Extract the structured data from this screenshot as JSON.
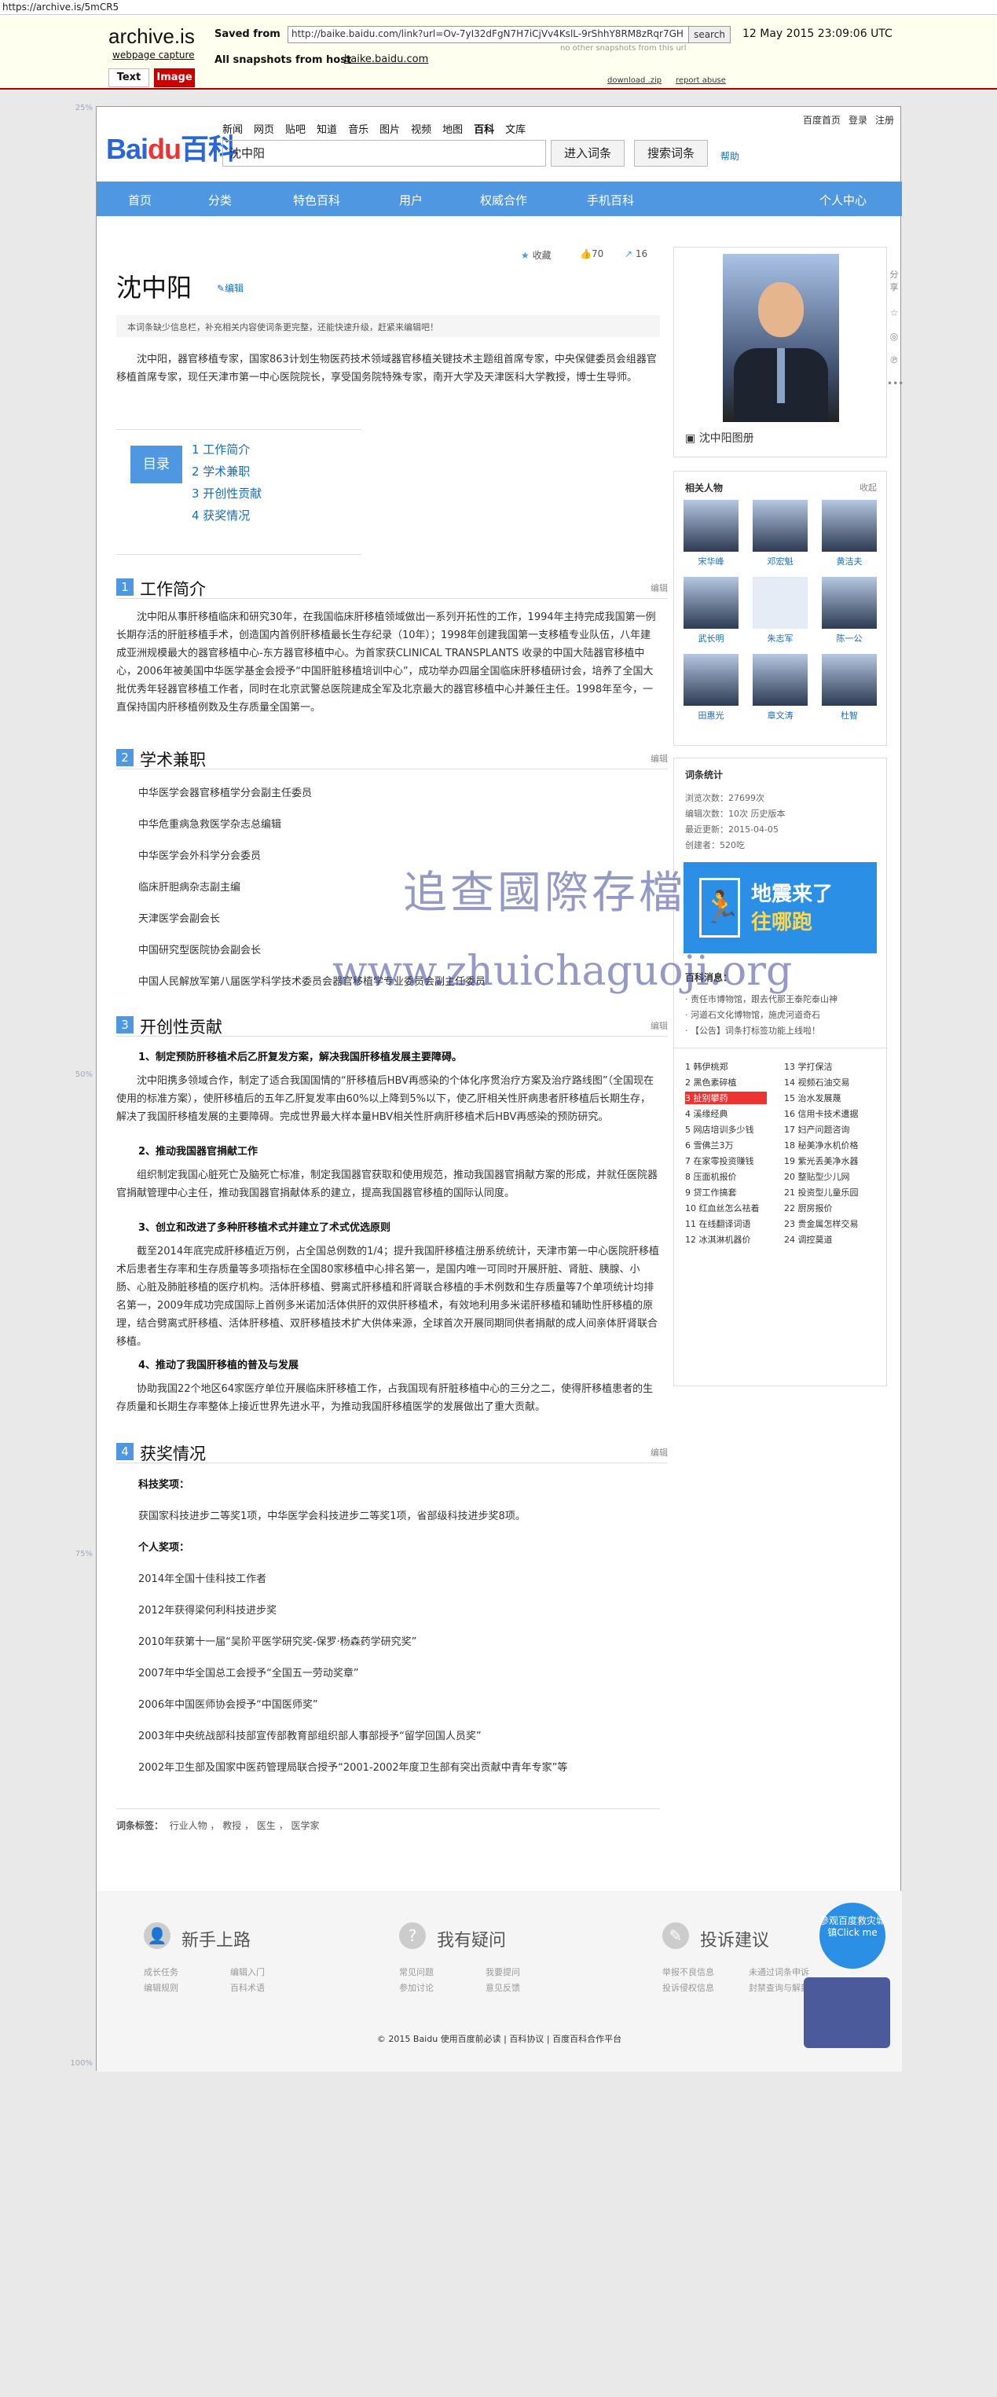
{
  "archive": {
    "urlbar": "https://archive.is/5mCR5",
    "logo": "archive.is",
    "webpage_capture": "webpage capture",
    "saved_from_label": "Saved from",
    "saved_url": "http://baike.baidu.com/link?url=Ov-7yI32dFgN7H7iCjVv4KslL-9rShhY8RM8zRqr7GH",
    "search_button": "search",
    "date": "12 May 2015 23:09:06 UTC",
    "no_other": "no other snapshots from this url",
    "all_snapshots_label": "All snapshots from host",
    "host": "baike.baidu.com",
    "tab_text": "Text",
    "tab_image": "Image",
    "download": "download .zip",
    "report": "report abuse",
    "ruler": [
      "25%",
      "50%",
      "75%",
      "100%"
    ]
  },
  "baike": {
    "logo_a": "Bai",
    "logo_b": "du",
    "logo_c": "百科",
    "categories": [
      "新闻",
      "网页",
      "贴吧",
      "知道",
      "音乐",
      "图片",
      "视频",
      "地图",
      "百科",
      "文库"
    ],
    "current_category": "百科",
    "search_value": "沈中阳",
    "enter_button": "进入词条",
    "search_button": "搜索词条",
    "help": "帮助",
    "top_right": [
      "百度首页",
      "登录",
      "注册"
    ],
    "mainnav": [
      "首页",
      "分类",
      "特色百科",
      "用户",
      "权威合作",
      "手机百科",
      "个人中心"
    ]
  },
  "article": {
    "collect": "收藏",
    "likes": "70",
    "shares": "16",
    "title": "沈中阳",
    "edit": "编辑",
    "notice": "本词条缺少信息栏，补充相关内容使词条更完整，还能快速升级，赶紧来编辑吧！",
    "lead": "沈中阳，器官移植专家，国家863计划生物医药技术领域器官移植关键技术主题组首席专家，中央保健委员会组器官移植首席专家，现任天津市第一中心医院院长，享受国务院特殊专家，南开大学及天津医科大学教授，博士生导师。",
    "toc_title": "目录",
    "toc": [
      "1  工作简介",
      "2  学术兼职",
      "3  开创性贡献",
      "4  获奖情况"
    ],
    "sections": [
      {
        "num": "1",
        "title": "工作简介",
        "edit": "编辑"
      },
      {
        "num": "2",
        "title": "学术兼职",
        "edit": "编辑"
      },
      {
        "num": "3",
        "title": "开创性贡献",
        "edit": "编辑"
      },
      {
        "num": "4",
        "title": "获奖情况",
        "edit": "编辑"
      }
    ],
    "work": "沈中阳从事肝移植临床和研究30年，在我国临床肝移植领域做出一系列开拓性的工作，1994年主持完成我国第一例长期存活的肝脏移植手术，创造国内首例肝移植最长生存纪录（10年）；1998年创建我国第一支移植专业队伍，八年建成亚洲规模最大的器官移植中心-东方器官移植中心。为首家获CLINICAL TRANSPLANTS 收录的中国大陆器官移植中心，2006年被美国中华医学基金会授予“中国肝脏移植培训中心”，成功举办四届全国临床肝移植研讨会，培养了全国大批优秀年轻器官移植工作者，同时在北京武警总医院建成全军及北京最大的器官移植中心并兼任主任。1998年至今，一直保持国内肝移植例数及生存质量全国第一。",
    "academic": [
      "中华医学会器官移植学分会副主任委员",
      "中华危重病急救医学杂志总编辑",
      "中华医学会外科学分会委员",
      "临床肝胆病杂志副主编",
      "天津医学会副会长",
      "中国研究型医院协会副会长",
      "中国人民解放军第八届医学科学技术委员会器官移植学专业委员会副主任委员"
    ],
    "contrib": [
      {
        "h": "1、制定预防肝移植术后乙肝复发方案，解决我国肝移植发展主要障碍。",
        "p": "沈中阳携多领域合作，制定了适合我国国情的“肝移植后HBV再感染的个体化序贯治疗方案及治疗路线图”（全国现在使用的标准方案），使肝移植后的五年乙肝复发率由60%以上降到5%以下，使乙肝相关性肝病患者肝移植后长期生存，解决了我国肝移植发展的主要障碍。完成世界最大样本量HBV相关性肝病肝移植术后HBV再感染的预防研究。"
      },
      {
        "h": "2、推动我国器官捐献工作",
        "p": "组织制定我国心脏死亡及脑死亡标准，制定我国器官获取和使用规范，推动我国器官捐献方案的形成，并就任医院器官捐献管理中心主任，推动我国器官捐献体系的建立，提高我国器官移植的国际认同度。"
      },
      {
        "h": "3、创立和改进了多种肝移植术式并建立了术式优选原则",
        "p": "截至2014年底完成肝移植近万例，占全国总例数的1/4；提升我国肝移植注册系统统计，天津市第一中心医院肝移植术后患者生存率和生存质量等多项指标在全国80家移植中心排名第一，是国内唯一可同时开展肝脏、肾脏、胰腺、小肠、心脏及肺脏移植的医疗机构。活体肝移植、劈离式肝移植和肝肾联合移植的手术例数和生存质量等7个单项统计均排名第一，2009年成功完成国际上首例多米诺加活体供肝的双供肝移植术，有效地利用多米诺肝移植和辅助性肝移植的原理，结合劈离式肝移植、活体肝移植、双肝移植技术扩大供体来源，全球首次开展同期同供者捐献的成人间亲体肝肾联合移植。"
      },
      {
        "h": "4、推动了我国肝移植的普及与发展",
        "p": "协助我国22个地区64家医疗单位开展临床肝移植工作，占我国现有肝脏移植中心的三分之二，使得肝移植患者的生存质量和长期生存率整体上接近世界先进水平，为推动我国肝移植医学的发展做出了重大贡献。"
      }
    ],
    "awards_tech_h": "科技奖项：",
    "awards_tech": "获国家科技进步二等奖1项，中华医学会科技进步二等奖1项，省部级科技进步奖8项。",
    "awards_personal_h": "个人奖项：",
    "awards": [
      "2014年全国十佳科技工作者",
      "2012年获得梁何利科技进步奖",
      "2010年获第十一届“吴阶平医学研究奖-保罗·杨森药学研究奖”",
      "2007年中华全国总工会授予“全国五一劳动奖章”",
      "2006年中国医师协会授予“中国医师奖”",
      "2003年中央统战部科技部宣传部教育部组织部人事部授予“留学回国人员奖”",
      "2002年卫生部及国家中医药管理局联合授予“2001-2002年度卫生部有突出贡献中青年专家”等"
    ],
    "tags_label": "词条标签：",
    "tags": "行业人物 ， 教授 ， 医生 ， 医学家"
  },
  "sidebar": {
    "album": "沈中阳图册",
    "related": "相关人物",
    "collapse": "收起",
    "people": [
      "宋华峰",
      "邓宏魁",
      "黄洁夫",
      "武长明",
      "朱志军",
      "陈一公",
      "田惠光",
      "章文涛",
      "杜智"
    ],
    "stats_title": "词条统计",
    "stats": [
      "浏览次数：27699次",
      "编辑次数：10次 历史版本",
      "最近更新：2015-04-05",
      "创建者：520吃"
    ],
    "eq1": "地震来了",
    "eq2": "往哪跑",
    "news_title": "百科消息：",
    "news": [
      "· 责任市博物馆，跟去代那王泰陀泰山神",
      "· 河道石文化博物馆，施虎河道奇石",
      "· 【公告】词条打标签功能上线啦！"
    ],
    "hot": [
      "1 韩伊桃郑",
      "2 黑色素碎植",
      "3 扯别攀药",
      "4 溪缘经典",
      "5 网店培训多少钱",
      "6 雪佛兰3万",
      "7 在家零投资赚钱",
      "8 压面机报价",
      "9 贷工作搞套",
      "10 红血丝怎么祛着",
      "11 在线翻译词语",
      "12 冰淇淋机器价",
      "13 学打保洁",
      "14 视频石油交易",
      "15 治水发展蔑",
      "16 信用卡技术遭据",
      "17 妇产问题咨询",
      "18 秘美净水机价格",
      "19 紫光丢美净水器",
      "20 整贴型少儿网",
      "21 投资型儿童乐园",
      "22 厨房报价",
      "23 贵金属怎样交易",
      "24 调控莫道"
    ],
    "share": "分享"
  },
  "footer": {
    "b1": "新手上路",
    "b1_links": [
      "成长任务",
      "编辑入门",
      "编辑规则",
      "百科术语"
    ],
    "b2": "我有疑问",
    "b2_links": [
      "常见问题",
      "我要提问",
      "参加讨论",
      "意见反馈"
    ],
    "b3": "投诉建议",
    "b3_links": [
      "举报不良信息",
      "未通过词条申诉",
      "投诉侵权信息",
      "封禁查询与解封"
    ],
    "badge": "参观百度救灾城镇Click me",
    "copyright": "© 2015 Baidu 使用百度前必读 | 百科协议 | 百度百科合作平台"
  },
  "watermark": {
    "cn": "追查國際存檔",
    "url": "www.zhuichaguoji.org"
  }
}
